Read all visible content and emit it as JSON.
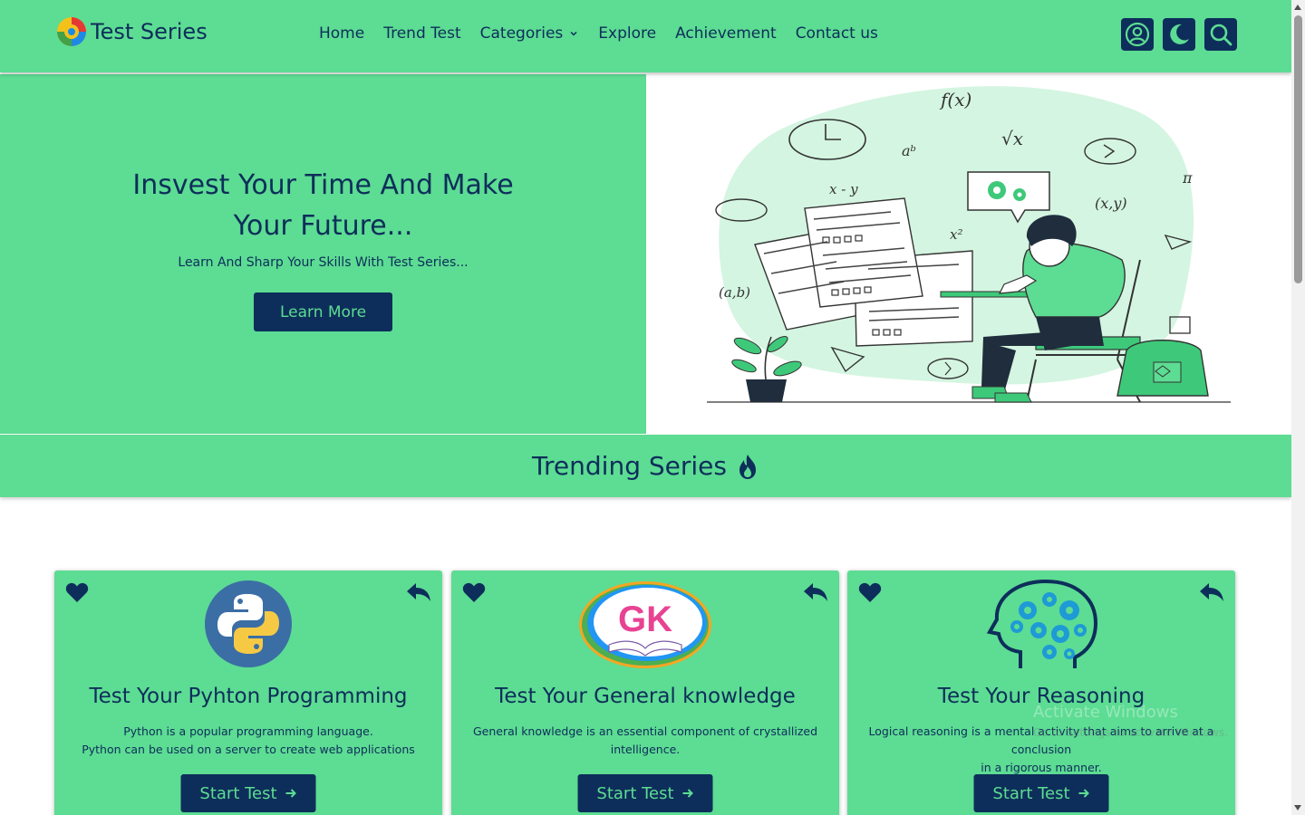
{
  "colors": {
    "accent": "#5ddc93",
    "navy": "#0d2e5a",
    "background": "#ffffff"
  },
  "brand": {
    "name": "Test Series",
    "logo_icon": "multicolor-circle-logo"
  },
  "nav": {
    "items": [
      {
        "label": "Home"
      },
      {
        "label": "Trend Test"
      },
      {
        "label": "Categories",
        "has_dropdown": true
      },
      {
        "label": "Explore"
      },
      {
        "label": "Achievement"
      },
      {
        "label": "Contact us"
      }
    ]
  },
  "header_icons": [
    "user-icon",
    "moon-icon",
    "search-icon"
  ],
  "hero": {
    "title_line1": "Insvest Your Time And Make",
    "title_line2": "Your Future...",
    "subtitle": "Learn And Sharp Your Skills With Test Series...",
    "button": "Learn More",
    "illustration_labels": [
      "f(x)",
      "√x",
      "aᵇ",
      "x - y",
      "x²",
      "(x,y)",
      "π",
      "(a,b)"
    ]
  },
  "trending": {
    "title": "Trending Series",
    "icon": "flame-icon"
  },
  "cards": [
    {
      "title": "Test Your Pyhton Programming",
      "desc_line1": "Python is a popular programming language.",
      "desc_line2": "Python can be used on a server to create web applications",
      "button": "Start Test",
      "image": "python-logo"
    },
    {
      "title": "Test Your General knowledge",
      "desc_line1": "General knowledge is an essential component of crystallized",
      "desc_line2": "intelligence.",
      "button": "Start Test",
      "image": "gk-logo",
      "image_text": "GK"
    },
    {
      "title": "Test Your Reasoning",
      "desc_line1": "Logical reasoning is a mental activity that aims to arrive at a conclusion",
      "desc_line2": "in a rigorous manner.",
      "button": "Start Test",
      "image": "brain-gears-icon"
    }
  ],
  "overlay": {
    "watermark_line1": "Activate Windows",
    "watermark_line2": "Go to Settings to activate Windows."
  }
}
